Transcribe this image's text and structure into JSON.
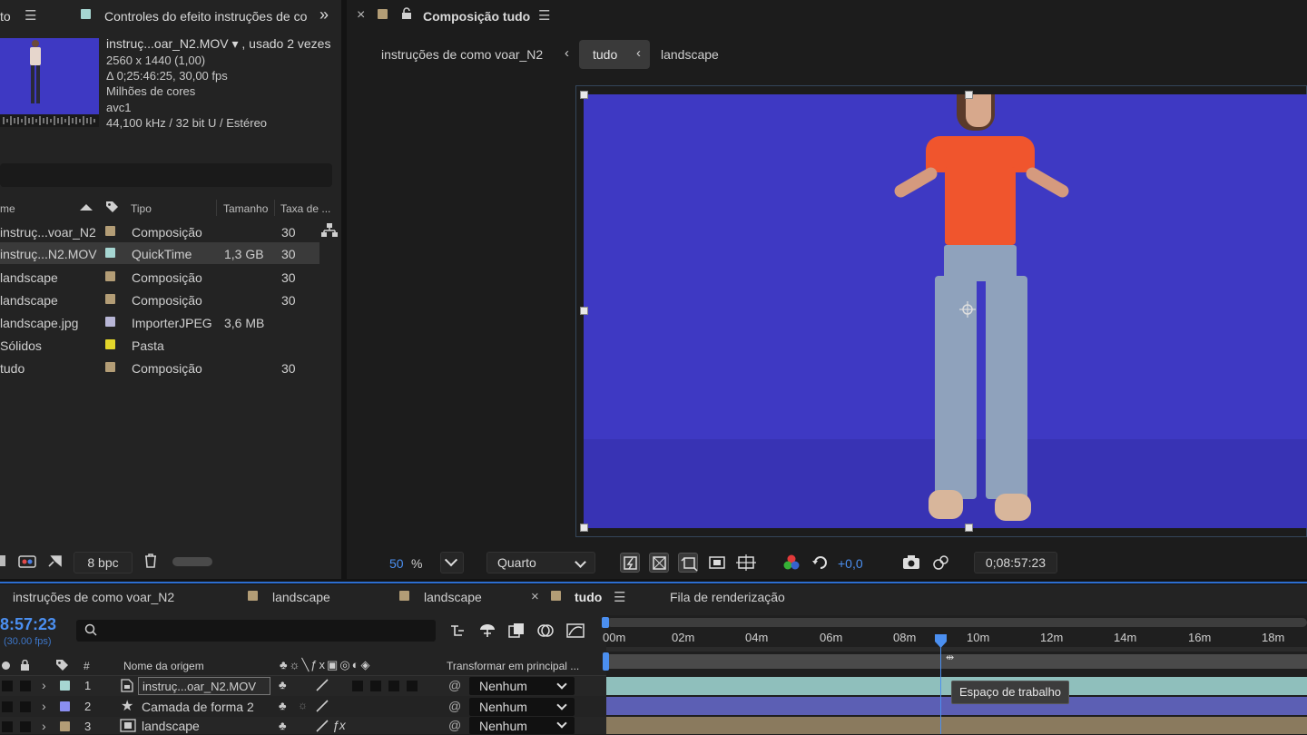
{
  "project": {
    "tab_partial": "to",
    "tab_effects": "Controles do efeito instruções de co",
    "overflow": "»",
    "item_name": "instruç...oar_N2.MOV ▾ , usado 2 vezes",
    "info": [
      "2560 x 1440 (1,00)",
      "Δ 0;25:46:25, 30,00 fps",
      "Milhões de cores",
      "avc1",
      "44,100 kHz / 32 bit U / Estéreo"
    ],
    "columns": {
      "name": "me",
      "type": "Tipo",
      "size": "Tamanho",
      "rate": "Taxa de ..."
    },
    "items": [
      {
        "name": "instruç...voar_N2",
        "type": "Composição",
        "size": "",
        "rate": "30",
        "color": "#b39d76"
      },
      {
        "name": "instruç...N2.MOV",
        "type": "QuickTime",
        "size": "1,3 GB",
        "rate": "30",
        "color": "#a6d6d2"
      },
      {
        "name": "landscape",
        "type": "Composição",
        "size": "",
        "rate": "30",
        "color": "#b39d76"
      },
      {
        "name": "landscape",
        "type": "Composição",
        "size": "",
        "rate": "30",
        "color": "#b39d76"
      },
      {
        "name": "landscape.jpg",
        "type": "ImporterJPEG",
        "size": "3,6 MB",
        "rate": "",
        "color": "#b8b6d6"
      },
      {
        "name": "Sólidos",
        "type": "Pasta",
        "size": "",
        "rate": "",
        "color": "#e3d62b"
      },
      {
        "name": "tudo",
        "type": "Composição",
        "size": "",
        "rate": "30",
        "color": "#b39d76"
      }
    ],
    "bpc": "8 bpc"
  },
  "composition": {
    "close": "×",
    "title": "Composição tudo",
    "breadcrumb": [
      "instruções de como voar_N2",
      "tudo",
      "landscape"
    ],
    "zoom": "50",
    "zoom_unit": "%",
    "resolution": "Quarto",
    "exposure": "+0,0",
    "timecode": "0;08:57:23"
  },
  "timeline": {
    "tabs": [
      "instruções de como voar_N2",
      "landscape",
      "landscape",
      "tudo",
      "Fila de renderização"
    ],
    "timecode": "8:57:23",
    "fps": "(30.00 fps)",
    "search_placeholder": "",
    "ruler": [
      "00m",
      "02m",
      "04m",
      "06m",
      "08m",
      "10m",
      "12m",
      "14m",
      "16m",
      "18m"
    ],
    "col_num": "#",
    "col_source": "Nome da origem",
    "col_parent": "Transformar em principal ...",
    "layers": [
      {
        "num": "1",
        "name": "instruç...oar_N2.MOV",
        "parent": "Nenhum",
        "label": "#a6d6d2"
      },
      {
        "num": "2",
        "name": "Camada de forma 2",
        "parent": "Nenhum",
        "label": "#8a8ef0"
      },
      {
        "num": "3",
        "name": "landscape",
        "parent": "Nenhum",
        "label": "#b39d76"
      }
    ],
    "tooltip": "Espaço de trabalho"
  }
}
